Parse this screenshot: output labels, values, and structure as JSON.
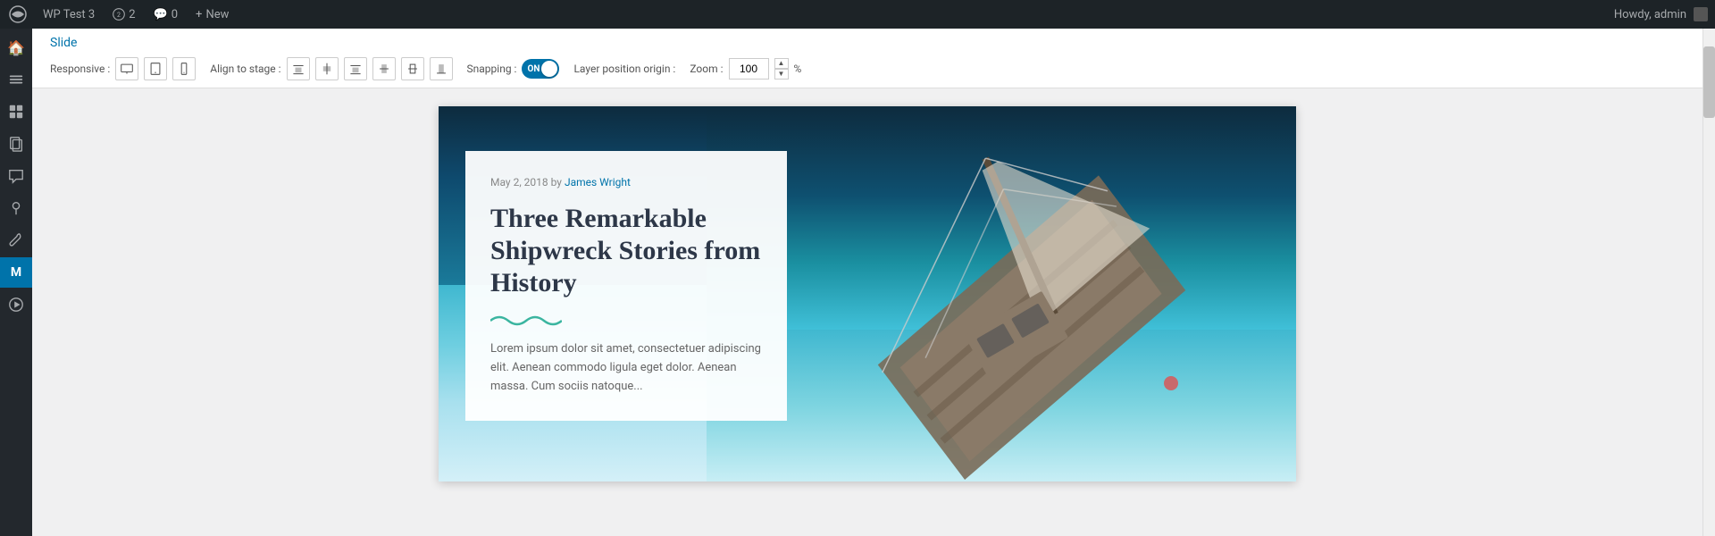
{
  "adminbar": {
    "logo_title": "WordPress",
    "site_name": "WP Test 3",
    "updates_count": "2",
    "comments_count": "0",
    "new_label": "New",
    "howdy": "Howdy, admin"
  },
  "editor": {
    "slide_label": "Slide",
    "toolbar": {
      "responsive_label": "Responsive :",
      "align_stage_label": "Align to stage :",
      "snapping_label": "Snapping :",
      "snapping_state": "ON",
      "layer_position_label": "Layer position origin :",
      "zoom_label": "Zoom :",
      "zoom_value": "100",
      "zoom_unit": "%"
    }
  },
  "slide": {
    "post_date": "May 2, 2018",
    "post_by": "by",
    "post_author": "James Wright",
    "post_title": "Three Remarkable Shipwreck Stories from History",
    "post_excerpt": "Lorem ipsum dolor sit amet, consectetuer adipiscing elit. Aenean commodo ligula eget dolor. Aenean massa. Cum sociis natoque..."
  },
  "sidebar": {
    "items": [
      {
        "name": "home-icon",
        "icon": "⌂"
      },
      {
        "name": "layers-icon",
        "icon": "◧"
      },
      {
        "name": "grid-icon",
        "icon": "⊞"
      },
      {
        "name": "pages-icon",
        "icon": "⧉"
      },
      {
        "name": "comments-icon",
        "icon": "💬"
      },
      {
        "name": "pin-icon",
        "icon": "📌"
      },
      {
        "name": "wrench-icon",
        "icon": "🔧"
      },
      {
        "name": "plugin-icon",
        "icon": "M"
      },
      {
        "name": "media-icon",
        "icon": "▶"
      }
    ]
  }
}
